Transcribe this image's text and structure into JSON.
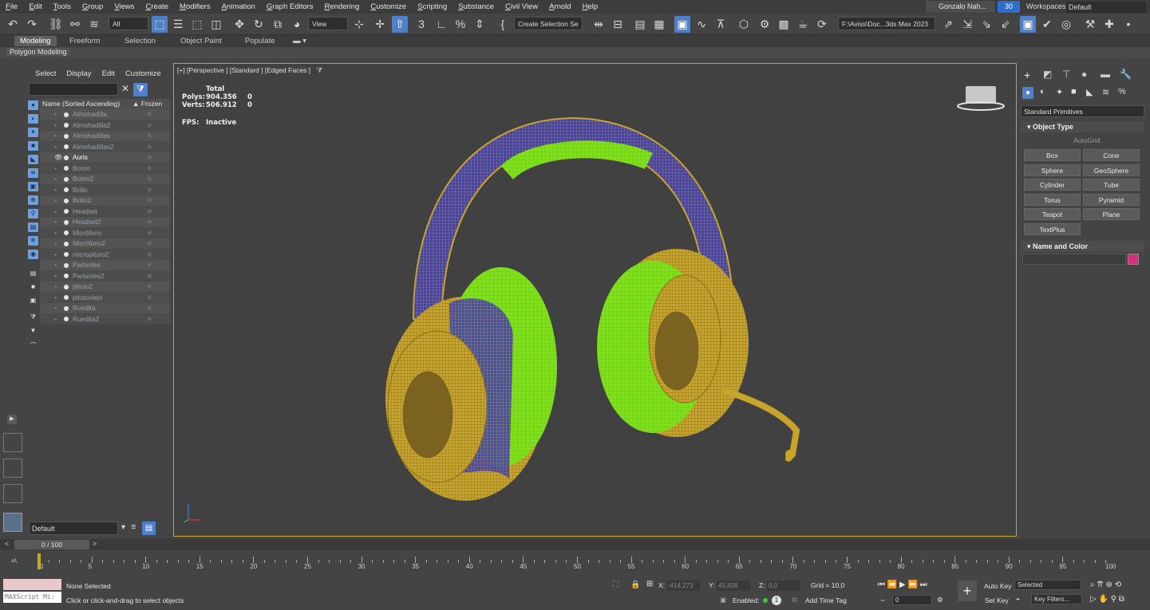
{
  "menu": [
    "File",
    "Edit",
    "Tools",
    "Group",
    "Views",
    "Create",
    "Modifiers",
    "Animation",
    "Graph Editors",
    "Rendering",
    "Customize",
    "Scripting",
    "Substance",
    "Civil View",
    "Arnold",
    "Help"
  ],
  "user": "Gonzalo Nah...",
  "clock_badge": "30",
  "workspaces_label": "Workspaces:",
  "workspace_value": "Default",
  "toolbar": {
    "filter_all": "All",
    "view_select": "View",
    "create_selection_set": "Create Selection Se",
    "project_path": "F:\\Aviss\\Doc...3ds Max 2023"
  },
  "ribbon_tabs": [
    "Modeling",
    "Freeform",
    "Selection",
    "Object Paint",
    "Populate"
  ],
  "ribbon_subtab": "Polygon Modeling",
  "explorer": {
    "menu": [
      "Select",
      "Display",
      "Edit",
      "Customize"
    ],
    "col_name": "Name (Sorted Ascending)",
    "col_frozen": "▲ Frozen",
    "objects": [
      {
        "name": "Almohadilla",
        "selected": false
      },
      {
        "name": "Almohadilla2",
        "selected": false
      },
      {
        "name": "Almohadillas",
        "selected": false
      },
      {
        "name": "Almohadillas2",
        "selected": false
      },
      {
        "name": "Auris",
        "selected": true
      },
      {
        "name": "Boton",
        "selected": false
      },
      {
        "name": "Boton2",
        "selected": false
      },
      {
        "name": "Brillo",
        "selected": false
      },
      {
        "name": "Brillo2",
        "selected": false
      },
      {
        "name": "Headset",
        "selected": false
      },
      {
        "name": "Headset2",
        "selected": false
      },
      {
        "name": "Micrófono",
        "selected": false
      },
      {
        "name": "Micrófono2",
        "selected": false
      },
      {
        "name": "micropituto2",
        "selected": false
      },
      {
        "name": "Parlantes",
        "selected": false
      },
      {
        "name": "Parlantes2",
        "selected": false
      },
      {
        "name": "pituto2",
        "selected": false
      },
      {
        "name": "pitutoviejo",
        "selected": false
      },
      {
        "name": "Ruedita",
        "selected": false
      },
      {
        "name": "Ruedita2",
        "selected": false
      }
    ],
    "layer": "Default"
  },
  "viewport": {
    "label": "[+] [Perspective ] [Standard ] [Edged Faces ]",
    "stats_total": "Total",
    "polys_label": "Polys:",
    "polys_value": "904.356",
    "polys_sel": "0",
    "verts_label": "Verts:",
    "verts_value": "506.912",
    "verts_sel": "0",
    "fps_label": "FPS:",
    "fps_value": "Inactive",
    "colors": {
      "wire": "#c9a42a",
      "green": "#7fe01c",
      "blue": "#3a3fd0"
    }
  },
  "command_panel": {
    "category": "Standard Primitives",
    "object_type_title": "Object Type",
    "autogrid": "AutoGrid",
    "buttons": [
      "Box",
      "Cone",
      "Sphere",
      "GeoSphere",
      "Cylinder",
      "Tube",
      "Torus",
      "Pyramid",
      "Teapot",
      "Plane",
      "TextPlus"
    ],
    "name_color_title": "Name and Color",
    "object_color": "#d1307e"
  },
  "timeline": {
    "frame": "0 / 100",
    "ticks": [
      "0",
      "5",
      "10",
      "15",
      "20",
      "25",
      "30",
      "35",
      "40",
      "45",
      "50",
      "55",
      "60",
      "65",
      "70",
      "75",
      "80",
      "85",
      "90",
      "95",
      "100"
    ]
  },
  "status": {
    "maxscript": "MAXScript Mi:",
    "selection": "None Selected",
    "prompt": "Click or click-and-drag to select objects",
    "x_label": "X:",
    "x_value": "-414,273",
    "y_label": "Y:",
    "y_value": "45,806",
    "z_label": "Z:",
    "z_value": "0,0",
    "grid": "Grid = 10,0",
    "enabled": "Enabled:",
    "add_time_tag": "Add Time Tag",
    "auto_key": "Auto Key",
    "selected": "Selected",
    "set_key": "Set Key",
    "key_filters": "Key Filters...",
    "frame_field": "0"
  }
}
